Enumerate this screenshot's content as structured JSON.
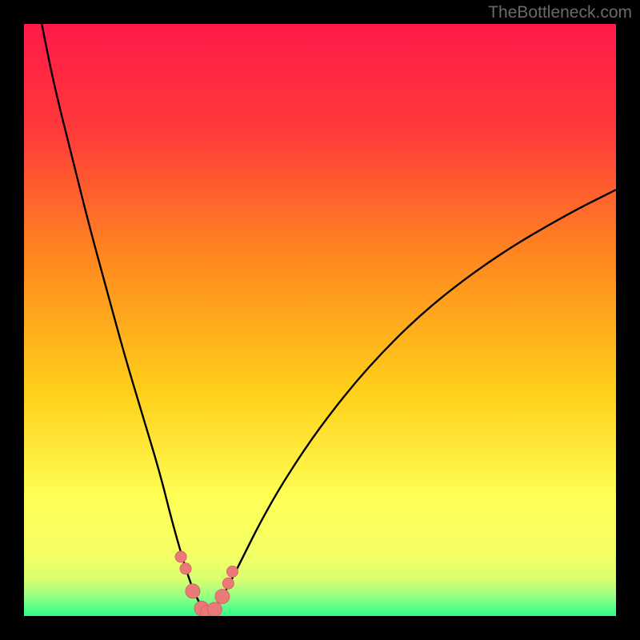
{
  "watermark": "TheBottleneck.com",
  "colors": {
    "page_bg": "#000000",
    "gradient_top": "#ff1a4a",
    "gradient_mid1": "#ff6a2a",
    "gradient_mid2": "#ffd400",
    "gradient_mid3": "#ffff3a",
    "gradient_bottom_band": "#e6ff66",
    "gradient_green": "#2dff8a",
    "curve_stroke": "#000000",
    "marker_fill": "#e97a78",
    "marker_stroke": "#d86562"
  },
  "chart_data": {
    "type": "line",
    "title": "",
    "xlabel": "",
    "ylabel": "",
    "xlim": [
      0,
      100
    ],
    "ylim": [
      0,
      100
    ],
    "notch_x": 31,
    "series": [
      {
        "name": "bottleneck-curve",
        "x": [
          3,
          5,
          8,
          11,
          14,
          17,
          20,
          23,
          25,
          27,
          28.5,
          30,
          31,
          32,
          33.5,
          35,
          37,
          40,
          44,
          50,
          58,
          68,
          80,
          92,
          100
        ],
        "y": [
          100,
          90,
          78,
          66,
          55,
          44,
          34,
          24,
          16,
          9,
          4.5,
          1.5,
          0.5,
          1.2,
          3.2,
          6,
          10,
          16,
          23,
          32,
          42,
          52,
          61,
          68,
          72
        ]
      }
    ],
    "markers": {
      "name": "highlight-points",
      "x": [
        26.5,
        27.3,
        28.5,
        30.0,
        31.0,
        32.2,
        33.5,
        34.5,
        35.2
      ],
      "y": [
        10.0,
        8.0,
        4.2,
        1.3,
        0.6,
        1.1,
        3.3,
        5.5,
        7.5
      ],
      "r": [
        7,
        7,
        9,
        9,
        9,
        9,
        9,
        7,
        7
      ]
    }
  }
}
